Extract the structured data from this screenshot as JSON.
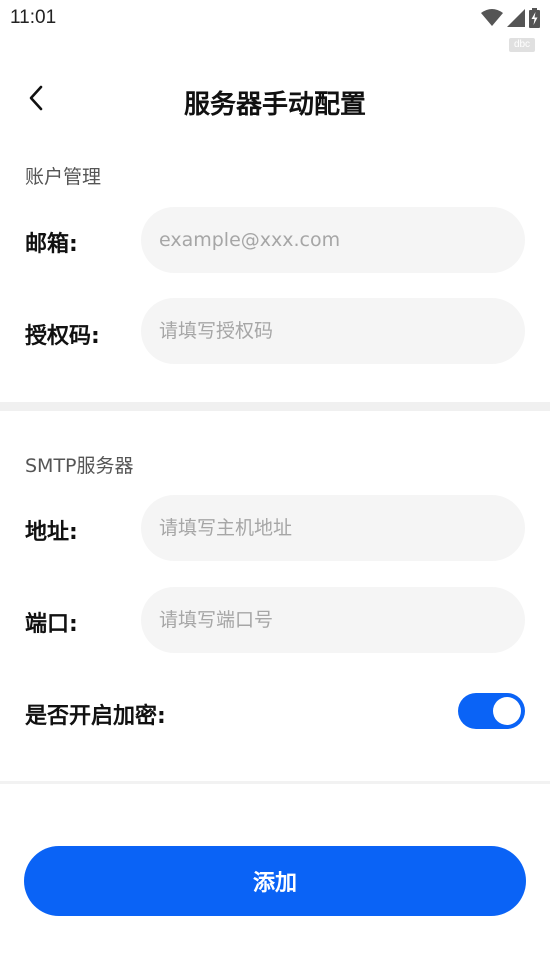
{
  "status_bar": {
    "time": "11:01",
    "icons": [
      "wifi-icon",
      "cell-signal-icon",
      "battery-charging-icon"
    ],
    "badge": "dbc"
  },
  "header": {
    "title": "服务器手动配置",
    "back_icon": "chevron-left-icon"
  },
  "account_section": {
    "label": "账户管理",
    "email": {
      "label": "邮箱:",
      "value": "",
      "placeholder": "example@xxx.com"
    },
    "auth_code": {
      "label": "授权码:",
      "value": "",
      "placeholder": "请填写授权码"
    }
  },
  "smtp_section": {
    "label": "SMTP服务器",
    "address": {
      "label": "地址:",
      "value": "",
      "placeholder": "请填写主机地址"
    },
    "port": {
      "label": "端口:",
      "value": "",
      "placeholder": "请填写端口号"
    },
    "encryption": {
      "label": "是否开启加密:",
      "enabled": true
    }
  },
  "add_button_label": "添加",
  "colors": {
    "accent": "#0a63f6",
    "input_bg": "#f5f5f5",
    "divider": "#f0f0f0",
    "placeholder": "#a6a6a6"
  }
}
